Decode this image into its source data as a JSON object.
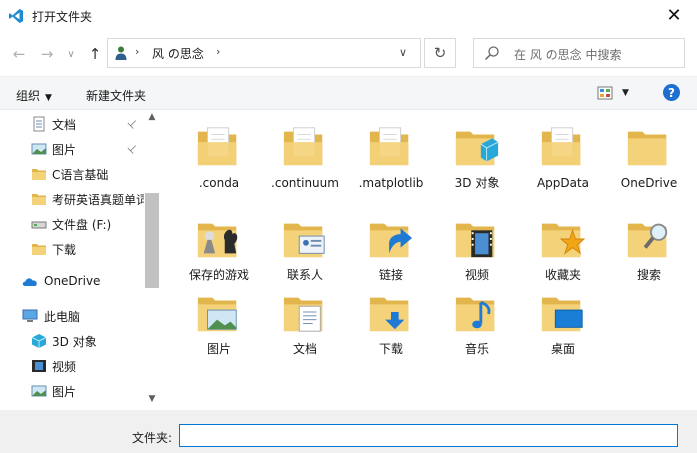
{
  "window": {
    "title": "打开文件夹",
    "close_glyph": "✕"
  },
  "nav": {
    "back_glyph": "←",
    "forward_glyph": "→",
    "recent_glyph": "∨",
    "up_glyph": "↑",
    "breadcrumb": [
      "风 の思念"
    ],
    "sep_glyph": "›",
    "dropdown_glyph": "∨",
    "refresh_glyph": "↻",
    "search_placeholder": "在 风 の思念 中搜索"
  },
  "toolbar": {
    "organize": "组织",
    "new_folder": "新建文件夹",
    "caret": "▼",
    "help": "?"
  },
  "sidebar": {
    "items": [
      {
        "label": "文档",
        "icon": "document-icon",
        "pinned": true
      },
      {
        "label": "图片",
        "icon": "pictures-icon",
        "pinned": true
      },
      {
        "label": "C语言基础",
        "icon": "folder-icon",
        "pinned": false
      },
      {
        "label": "考研英语真题单词",
        "icon": "folder-icon",
        "pinned": false
      },
      {
        "label": "文件盘 (F:)",
        "icon": "drive-icon",
        "pinned": false
      },
      {
        "label": "下载",
        "icon": "folder-icon",
        "pinned": false
      },
      {
        "label": "OneDrive",
        "icon": "cloud-icon",
        "pinned": false
      },
      {
        "label": "此电脑",
        "icon": "computer-icon",
        "pinned": false
      },
      {
        "label": "3D 对象",
        "icon": "cube-icon",
        "pinned": false
      },
      {
        "label": "视频",
        "icon": "video-icon",
        "pinned": false
      },
      {
        "label": "图片",
        "icon": "pictures-icon",
        "pinned": false
      }
    ],
    "pin_glyph": "📌"
  },
  "files": [
    {
      "name": ".conda",
      "icon": "folder-doc-icon"
    },
    {
      "name": ".continuum",
      "icon": "folder-doc-icon"
    },
    {
      "name": ".matplotlib",
      "icon": "folder-doc-icon"
    },
    {
      "name": "3D 对象",
      "icon": "folder-3d-icon"
    },
    {
      "name": "AppData",
      "icon": "folder-doc-icon"
    },
    {
      "name": "OneDrive",
      "icon": "folder-icon"
    },
    {
      "name": "保存的游戏",
      "icon": "folder-games-icon"
    },
    {
      "name": "联系人",
      "icon": "folder-contacts-icon"
    },
    {
      "name": "链接",
      "icon": "folder-links-icon"
    },
    {
      "name": "视频",
      "icon": "folder-video-icon"
    },
    {
      "name": "收藏夹",
      "icon": "folder-star-icon"
    },
    {
      "name": "搜索",
      "icon": "folder-search-icon"
    },
    {
      "name": "图片",
      "icon": "folder-pictures-icon"
    },
    {
      "name": "文档",
      "icon": "folder-documents-icon"
    },
    {
      "name": "下载",
      "icon": "folder-download-icon"
    },
    {
      "name": "音乐",
      "icon": "folder-music-icon"
    },
    {
      "name": "桌面",
      "icon": "folder-desktop-icon"
    }
  ],
  "footer": {
    "filename_label": "文件夹:",
    "filename_value": ""
  },
  "colors": {
    "folder": "#f4d27a",
    "folder_dark": "#e2b54d",
    "accent": "#0078d7",
    "help_blue": "#1f6fd0"
  }
}
